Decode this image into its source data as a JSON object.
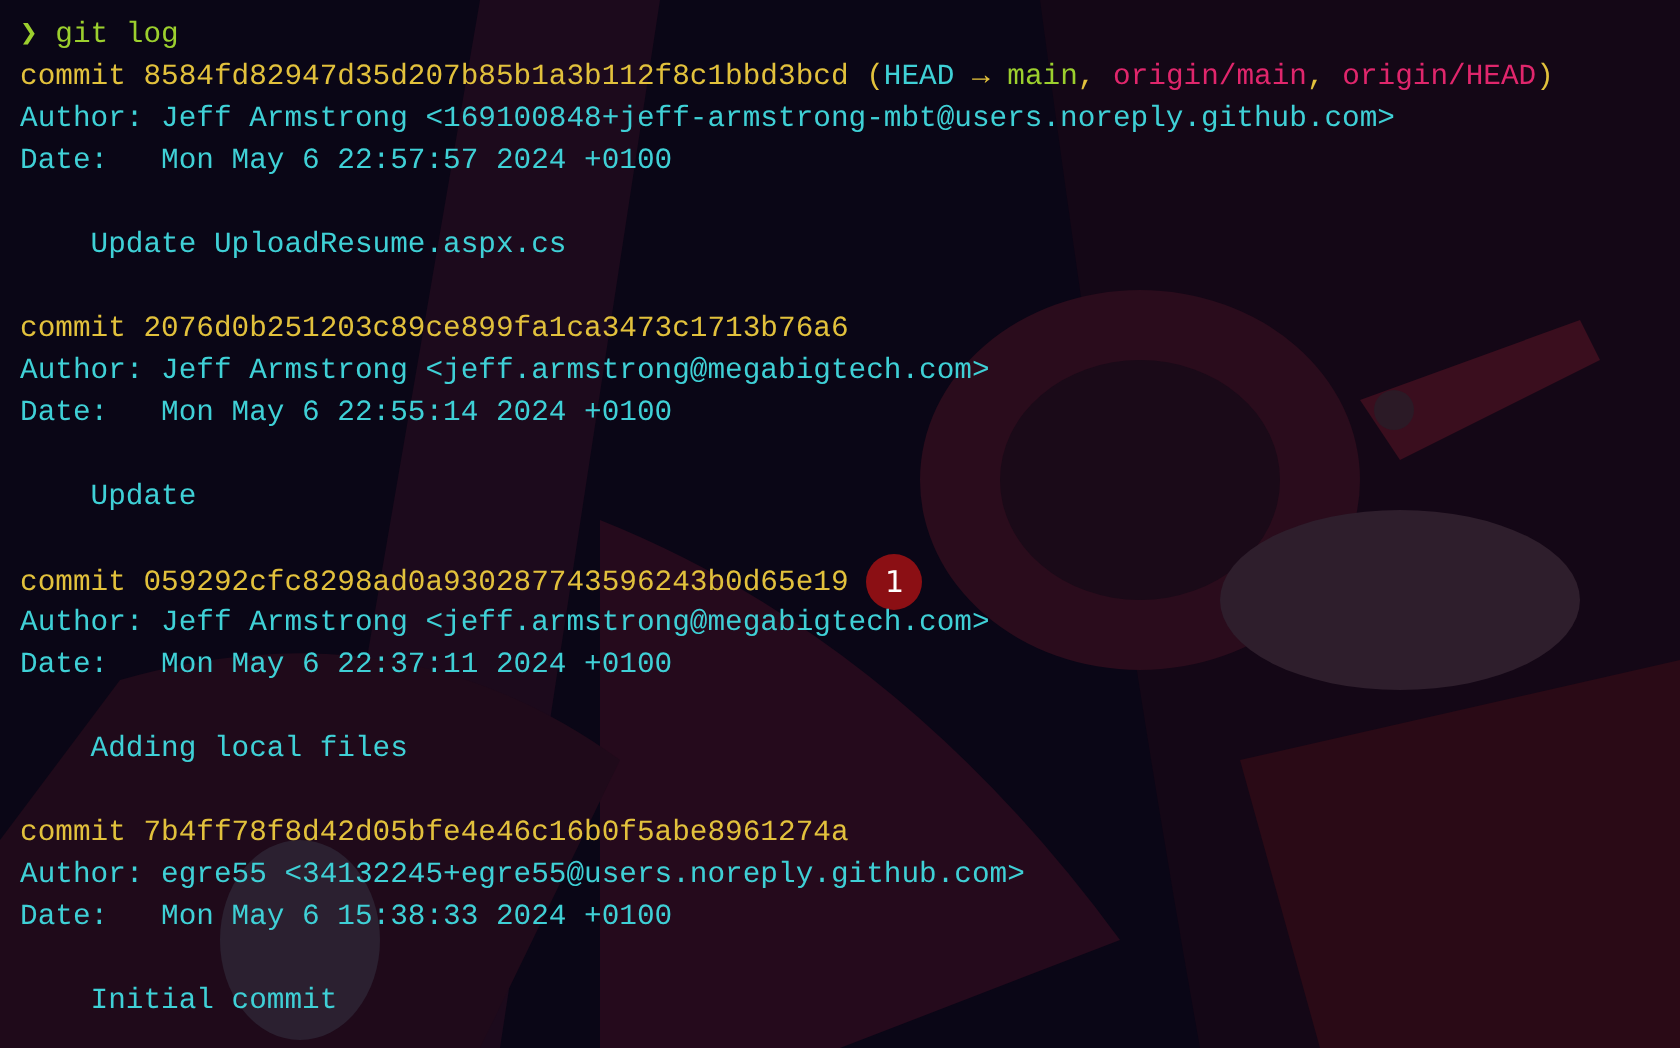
{
  "prompt": {
    "symbol": "❯",
    "command": "git log"
  },
  "commits": [
    {
      "label": "commit",
      "hash": "8584fd82947d35d207b85b1a3b112f8c1bbd3bcd",
      "refs": [
        {
          "text": "(",
          "kind": "punct"
        },
        {
          "text": "HEAD",
          "kind": "head"
        },
        {
          "text": " → ",
          "kind": "punct"
        },
        {
          "text": "main",
          "kind": "local"
        },
        {
          "text": ", ",
          "kind": "punct"
        },
        {
          "text": "origin/main",
          "kind": "remote"
        },
        {
          "text": ", ",
          "kind": "punct"
        },
        {
          "text": "origin/HEAD",
          "kind": "remote"
        },
        {
          "text": ")",
          "kind": "punct"
        }
      ],
      "author": "Author: Jeff Armstrong <169100848+jeff-armstrong-mbt@users.noreply.github.com>",
      "date": "Date:   Mon May 6 22:57:57 2024 +0100",
      "message": "Update UploadResume.aspx.cs"
    },
    {
      "label": "commit",
      "hash": "2076d0b251203c89ce899fa1ca3473c1713b76a6",
      "author": "Author: Jeff Armstrong <jeff.armstrong@megabigtech.com>",
      "date": "Date:   Mon May 6 22:55:14 2024 +0100",
      "message": "Update"
    },
    {
      "label": "commit",
      "hash": "059292cfc8298ad0a930287743596243b0d65e19",
      "badge": "1",
      "author": "Author: Jeff Armstrong <jeff.armstrong@megabigtech.com>",
      "date": "Date:   Mon May 6 22:37:11 2024 +0100",
      "message": "Adding local files"
    },
    {
      "label": "commit",
      "hash": "7b4ff78f8d42d05bfe4e46c16b0f5abe8961274a",
      "author": "Author: egre55 <34132245+egre55@users.noreply.github.com>",
      "date": "Date:   Mon May 6 15:38:33 2024 +0100",
      "message": "Initial commit"
    }
  ]
}
